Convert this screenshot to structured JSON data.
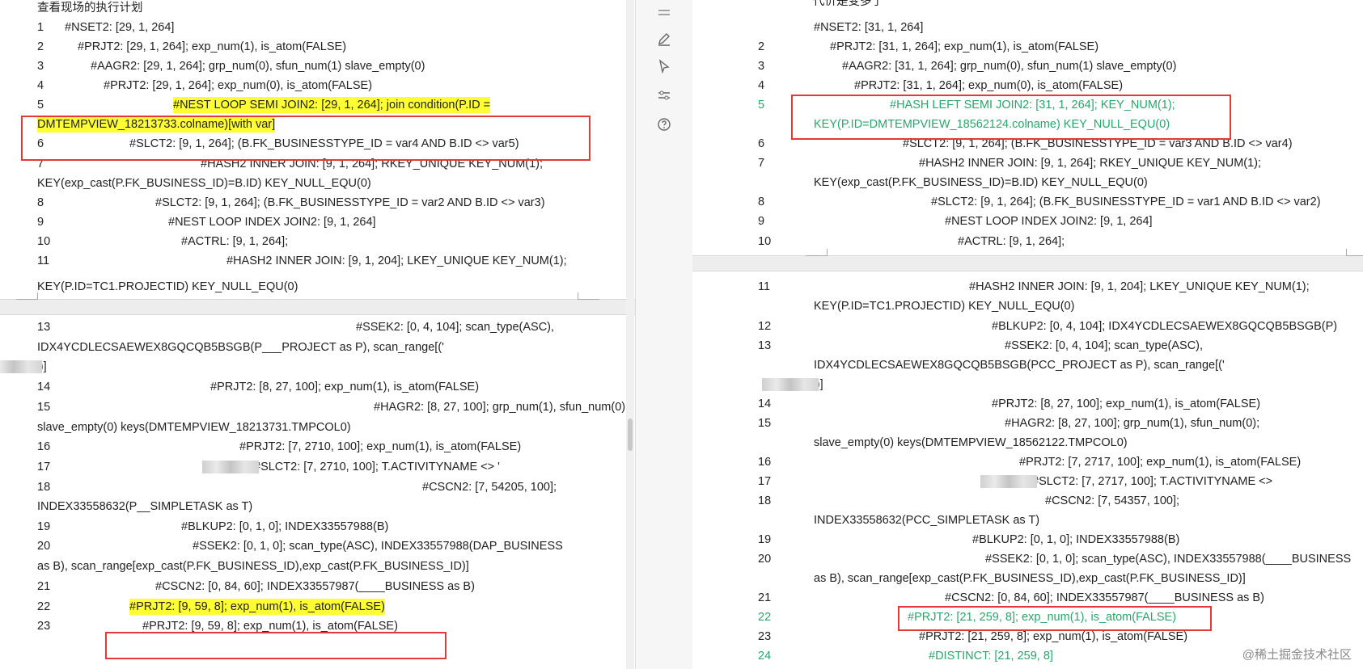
{
  "left": {
    "header": "查看现场的执行计划",
    "lines": [
      {
        "n": "1",
        "t": "#NSET2: [29, 1, 264]"
      },
      {
        "n": "2",
        "t": "#PRJT2: [29, 1, 264]; exp_num(1), is_atom(FALSE)"
      },
      {
        "n": "3",
        "t": "#AAGR2: [29, 1, 264]; grp_num(0), sfun_num(1) slave_empty(0)"
      },
      {
        "n": "4",
        "t": "#PRJT2: [29, 1, 264]; exp_num(0), is_atom(FALSE)"
      },
      {
        "n": "5",
        "t": "#NEST LOOP SEMI JOIN2: [29, 1, 264];     join condition(P.ID ="
      },
      {
        "n": "",
        "t": "DMTEMPVIEW_18213733.colname)[with var]"
      },
      {
        "n": "6",
        "t": "#SLCT2: [9, 1, 264]; (B.FK_BUSINESSTYPE_ID = var4 AND B.ID <> var5)"
      },
      {
        "n": "7",
        "t": "#HASH2 INNER JOIN: [9, 1, 264]; RKEY_UNIQUE KEY_NUM(1);"
      },
      {
        "n": "",
        "t": "KEY(exp_cast(P.FK_BUSINESS_ID)=B.ID) KEY_NULL_EQU(0)"
      },
      {
        "n": "8",
        "t": "#SLCT2: [9, 1, 264]; (B.FK_BUSINESSTYPE_ID = var2 AND B.ID <> var3)"
      },
      {
        "n": "9",
        "t": "#NEST LOOP INDEX JOIN2: [9, 1, 264]"
      },
      {
        "n": "10",
        "t": "#ACTRL: [9, 1, 264];"
      },
      {
        "n": "11",
        "t": "#HASH2 INNER JOIN: [9, 1, 204]; LKEY_UNIQUE KEY_NUM(1);"
      },
      {
        "n": "",
        "t": "KEY(P.ID=TC1.PROJECTID) KEY_NULL_EQU(0)"
      },
      {
        "n": "12",
        "t": "#BLKUP2: [0, 4, 104]; IDX4YCDLECSAEWEX8GQCQB5BSGB(P)"
      },
      {
        "n": "13",
        "t": "#SSEK2: [0, 4, 104]; scan_type(ASC),"
      },
      {
        "n": "",
        "t": "IDX4YCDLECSAEWEX8GQCQB5BSGB(P___PROJECT as P), scan_range[('"
      },
      {
        "n": "",
        "t": "')]"
      },
      {
        "n": "14",
        "t": "#PRJT2: [8, 27, 100]; exp_num(1), is_atom(FALSE)"
      },
      {
        "n": "15",
        "t": "#HAGR2: [8, 27, 100]; grp_num(1), sfun_num(0);"
      },
      {
        "n": "",
        "t": "slave_empty(0) keys(DMTEMPVIEW_18213731.TMPCOL0)"
      },
      {
        "n": "16",
        "t": "#PRJT2: [7, 2710, 100]; exp_num(1), is_atom(FALSE)"
      },
      {
        "n": "17",
        "t": "#SLCT2: [7, 2710, 100]; T.ACTIVITYNAME <> '"
      },
      {
        "n": "18",
        "t": "#CSCN2: [7, 54205, 100];"
      },
      {
        "n": "",
        "t": "INDEX33558632(P__SIMPLETASK as T)"
      },
      {
        "n": "19",
        "t": "#BLKUP2: [0, 1, 0]; INDEX33557988(B)"
      },
      {
        "n": "20",
        "t": "#SSEK2: [0, 1, 0]; scan_type(ASC), INDEX33557988(DAP_BUSINESS"
      },
      {
        "n": "",
        "t": "as B), scan_range[exp_cast(P.FK_BUSINESS_ID),exp_cast(P.FK_BUSINESS_ID)]"
      },
      {
        "n": "21",
        "t": "#CSCN2: [0, 84, 60]; INDEX33557987(____BUSINESS as B)"
      },
      {
        "n": "22",
        "t": "#PRJT2: [9, 59, 8]; exp_num(1), is_atom(FALSE)"
      },
      {
        "n": "23",
        "t": "#PRJT2: [9, 59, 8]; exp_num(1), is_atom(FALSE)"
      }
    ]
  },
  "right": {
    "header": "代价是变多了",
    "lines": [
      {
        "n": "",
        "t": "#NSET2: [31, 1, 264]"
      },
      {
        "n": "2",
        "t": "#PRJT2: [31, 1, 264]; exp_num(1), is_atom(FALSE)"
      },
      {
        "n": "3",
        "t": "#AAGR2: [31, 1, 264]; grp_num(0), sfun_num(1) slave_empty(0)"
      },
      {
        "n": "4",
        "t": "#PRJT2: [31, 1, 264]; exp_num(0), is_atom(FALSE)"
      },
      {
        "n": "5",
        "t": "#HASH LEFT SEMI JOIN2: [31, 1, 264]; KEY_NUM(1);"
      },
      {
        "n": "",
        "t": "KEY(P.ID=DMTEMPVIEW_18562124.colname) KEY_NULL_EQU(0)"
      },
      {
        "n": "6",
        "t": "#SLCT2: [9, 1, 264]; (B.FK_BUSINESSTYPE_ID = var3 AND B.ID <> var4)"
      },
      {
        "n": "7",
        "t": "#HASH2 INNER JOIN: [9, 1, 264]; RKEY_UNIQUE KEY_NUM(1);"
      },
      {
        "n": "",
        "t": "KEY(exp_cast(P.FK_BUSINESS_ID)=B.ID) KEY_NULL_EQU(0)"
      },
      {
        "n": "8",
        "t": "#SLCT2: [9, 1, 264]; (B.FK_BUSINESSTYPE_ID = var1 AND B.ID <> var2)"
      },
      {
        "n": "9",
        "t": "#NEST LOOP INDEX JOIN2: [9, 1, 264]"
      },
      {
        "n": "10",
        "t": "#ACTRL: [9, 1, 264];"
      },
      {
        "n": "11",
        "t": "#HASH2 INNER JOIN: [9, 1, 204]; LKEY_UNIQUE KEY_NUM(1);"
      },
      {
        "n": "",
        "t": "KEY(P.ID=TC1.PROJECTID) KEY_NULL_EQU(0)"
      },
      {
        "n": "12",
        "t": "#BLKUP2: [0, 4, 104]; IDX4YCDLECSAEWEX8GQCQB5BSGB(P)"
      },
      {
        "n": "13",
        "t": "#SSEK2: [0, 4, 104]; scan_type(ASC),"
      },
      {
        "n": "",
        "t": "IDX4YCDLECSAEWEX8GQCQB5BSGB(PCC_PROJECT as P), scan_range[('"
      },
      {
        "n": "",
        "t": "')]"
      },
      {
        "n": "14",
        "t": "#PRJT2: [8, 27, 100]; exp_num(1), is_atom(FALSE)"
      },
      {
        "n": "15",
        "t": "#HAGR2: [8, 27, 100]; grp_num(1), sfun_num(0);"
      },
      {
        "n": "",
        "t": "slave_empty(0) keys(DMTEMPVIEW_18562122.TMPCOL0)"
      },
      {
        "n": "16",
        "t": "#PRJT2: [7, 2717, 100]; exp_num(1), is_atom(FALSE)"
      },
      {
        "n": "17",
        "t": "#SLCT2: [7, 2717, 100]; T.ACTIVITYNAME <>"
      },
      {
        "n": "18",
        "t": "#CSCN2: [7, 54357, 100];"
      },
      {
        "n": "",
        "t": "INDEX33558632(PCC_SIMPLETASK as T)"
      },
      {
        "n": "19",
        "t": "#BLKUP2: [0, 1, 0]; INDEX33557988(B)"
      },
      {
        "n": "20",
        "t": "#SSEK2: [0, 1, 0]; scan_type(ASC), INDEX33557988(____BUSINESS"
      },
      {
        "n": "",
        "t": "as B), scan_range[exp_cast(P.FK_BUSINESS_ID),exp_cast(P.FK_BUSINESS_ID)]"
      },
      {
        "n": "21",
        "t": "#CSCN2: [0, 84, 60]; INDEX33557987(____BUSINESS as B)"
      },
      {
        "n": "22",
        "t": "#PRJT2: [21, 259, 8]; exp_num(1), is_atom(FALSE)"
      },
      {
        "n": "23",
        "t": "#PRJT2: [21, 259, 8]; exp_num(1), is_atom(FALSE)"
      },
      {
        "n": "24",
        "t": "#DISTINCT: [21, 259, 8]"
      }
    ]
  },
  "toolbar": {
    "icons": [
      "menu-icon",
      "pen-icon",
      "cursor-icon",
      "sliders-icon",
      "help-icon"
    ]
  },
  "watermark": "@稀土掘金技术社区",
  "colors": {
    "highlight": "#ffff33",
    "red_box": "#e53935",
    "green_text": "#2aa56b"
  }
}
